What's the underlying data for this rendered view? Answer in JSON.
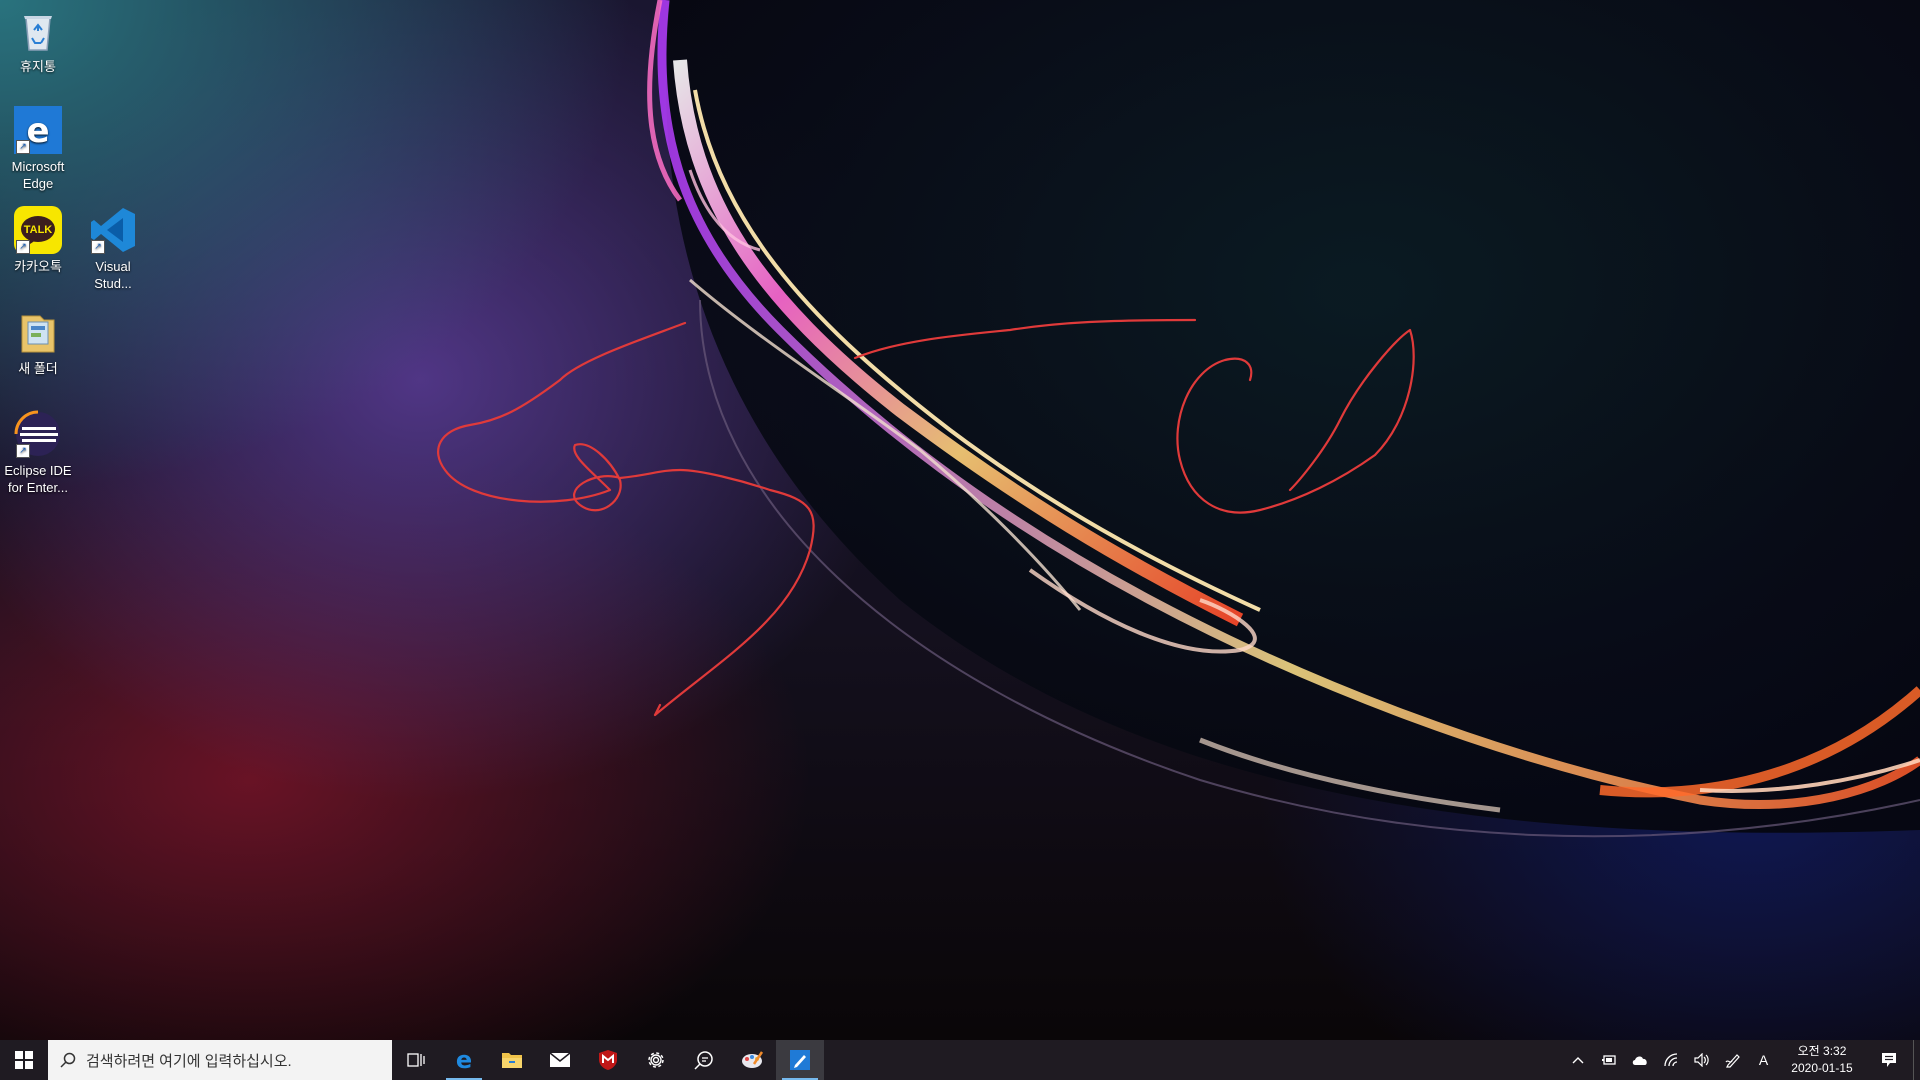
{
  "desktop": {
    "icons": [
      {
        "label": "휴지통",
        "icon": "recycle-bin-icon"
      },
      {
        "label": "Microsoft Edge",
        "icon": "edge-icon"
      },
      {
        "label": "카카오톡",
        "icon": "kakaotalk-icon",
        "badge": "TALK"
      },
      {
        "label": "Visual Stud...",
        "icon": "vscode-icon"
      },
      {
        "label": "새 폴더",
        "icon": "folder-icon"
      },
      {
        "label": "Eclipse IDE for Enter...",
        "icon": "eclipse-icon"
      }
    ],
    "ink_color": "#e03a3a"
  },
  "taskbar": {
    "search_placeholder": "검색하려면 여기에 입력하십시오.",
    "pinned": [
      "task-view",
      "edge",
      "file-explorer",
      "mail",
      "mcafee",
      "settings",
      "feedback-hub",
      "paint-3d",
      "sketchpad"
    ],
    "tray": {
      "lang": "A",
      "time": "오전 3:32",
      "date": "2020-01-15"
    },
    "accent": "#76b9ed"
  }
}
